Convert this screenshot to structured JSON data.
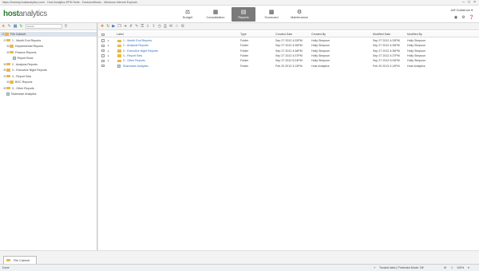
{
  "window": {
    "title": "https://forestry.hostanalytics.com/ - Host Analytics EPM Suite - DecisionWorks - Windows Internet Explorer"
  },
  "brand": {
    "name_bold": "host",
    "name_rest": "analytics"
  },
  "nav": {
    "budget": "Budget",
    "consolidation": "Consolidation",
    "reports": "Reports",
    "scorecard": "Scorecard",
    "maintenance": "Maintenance"
  },
  "user": {
    "name": "Jeff Goldstrom ▾"
  },
  "left_toolbar": {
    "search_placeholder": "Search"
  },
  "tree": {
    "root": "File Cabinet",
    "items": [
      "1 - Month End Reports",
      "Departmental Reports",
      "Finance Reports",
      "Report Book",
      "2 - Analysis Reports",
      "3 - Executive Night Reports",
      "4 - Report Sets",
      "BOC Reports",
      "5 - Other Reports",
      "Sharewise Analytics"
    ]
  },
  "grid": {
    "headers": {
      "label": "Label",
      "type": "Type",
      "created_date": "Created Date",
      "created_by": "Created By",
      "modified_date": "Modified Date",
      "modified_by": "Modified By"
    },
    "rows": [
      {
        "label": "1 - Month End Reports",
        "type": "Folder",
        "created_date": "Sep 27 2012 4:33PM",
        "created_by": "Holly Simpson",
        "modified_date": "Sep 27 2012 4:33PM",
        "modified_by": "Holly Simpson"
      },
      {
        "label": "2 - Analysis Reports",
        "type": "Folder",
        "created_date": "Sep 27 2012 4:35PM",
        "created_by": "Holly Simpson",
        "modified_date": "Sep 27 2012 4:35PM",
        "modified_by": "Holly Simpson"
      },
      {
        "label": "3 - Executive Night Reports",
        "type": "Folder",
        "created_date": "Sep 27 2012 4:36PM",
        "created_by": "Holly Simpson",
        "modified_date": "Sep 27 2012 4:36PM",
        "modified_by": "Holly Simpson"
      },
      {
        "label": "4 - Report Sets",
        "type": "Folder",
        "created_date": "Sep 27 2012 4:37PM",
        "created_by": "Holly Simpson",
        "modified_date": "Sep 27 2012 4:37PM",
        "modified_by": "Holly Simpson"
      },
      {
        "label": "5 - Other Reports",
        "type": "Folder",
        "created_date": "Sep 27 2012 5:24PM",
        "created_by": "Holly Simpson",
        "modified_date": "Sep 27 2012 5:24PM",
        "modified_by": "Holly Simpson"
      },
      {
        "label": "Sharewise Analytics",
        "type": "Folder",
        "created_date": "Feb 20 2013 3:13PM",
        "created_by": "Host Analytics",
        "modified_date": "Feb 20 2013 3:13PM",
        "modified_by": "Host Analytics"
      }
    ]
  },
  "bottom_tab": {
    "label": "File Cabinet"
  },
  "status": {
    "left": "Done",
    "zone": "Trusted sites | Protected Mode: Off",
    "zoom": "100%"
  }
}
